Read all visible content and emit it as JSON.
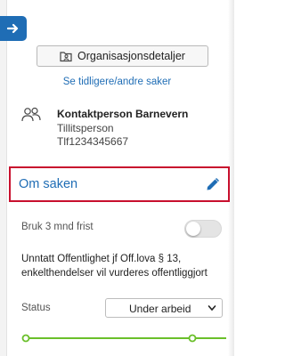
{
  "sidebar": {
    "org_button_label": "Organisasjonsdetaljer",
    "history_link": "Se tidligere/andre saker"
  },
  "contact": {
    "name": "Kontaktperson Barnevern",
    "role": "Tillitsperson",
    "phone": "Tlf1234345667"
  },
  "section": {
    "title": "Om saken"
  },
  "fields": {
    "deadline_label": "Bruk 3 mnd frist",
    "deadline_enabled": false,
    "publicity_text_line1": "Unntatt Offentlighet jf Off.lova § 13,",
    "publicity_text_line2": "enkelthendelser vil vurderes offentliggjort",
    "status_label": "Status",
    "status_value": "Under arbeid"
  },
  "progress": {
    "color": "#6abf2a",
    "start_fraction": 0,
    "marker_fraction": 0.85
  },
  "colors": {
    "accent": "#1f6db5",
    "highlight_border": "#c8102e"
  }
}
